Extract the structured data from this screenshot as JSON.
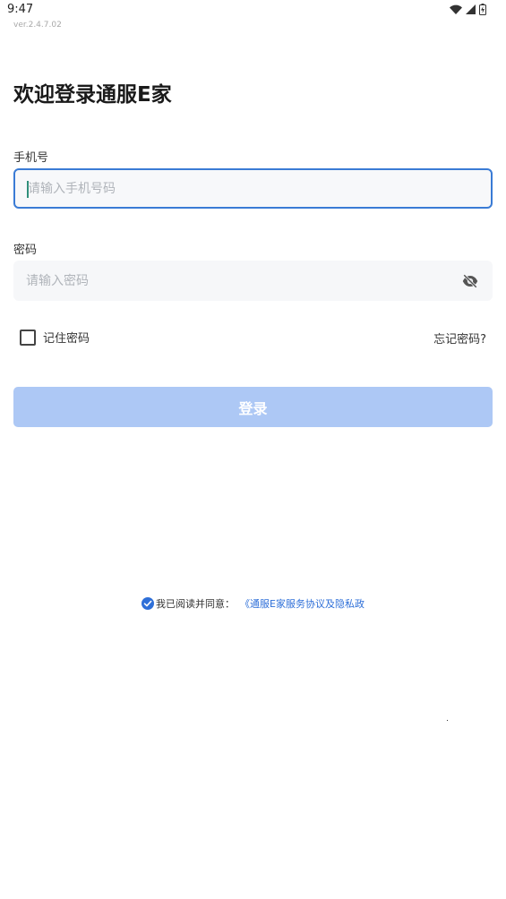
{
  "status_bar": {
    "time": "9:47"
  },
  "app": {
    "version": "ver.2.4.7.02",
    "title": "欢迎登录通服E家"
  },
  "form": {
    "phone": {
      "label": "手机号",
      "placeholder": "请输入手机号码",
      "value": ""
    },
    "password": {
      "label": "密码",
      "placeholder": "请输入密码",
      "value": ""
    },
    "remember_label": "记住密码",
    "remember_checked": false,
    "forgot_label": "忘记密码?",
    "login_label": "登录"
  },
  "agreement": {
    "checked": true,
    "text": "我已阅读并同意：",
    "link": "《通服E家服务协议及隐私政"
  },
  "colors": {
    "accent": "#3a7bd5",
    "button_disabled": "#adc8f5",
    "link": "#2e6fd8"
  },
  "icons": [
    "wifi-icon",
    "signal-icon",
    "battery-icon",
    "eye-off-icon",
    "checkbox-icon",
    "check-circle-icon"
  ]
}
